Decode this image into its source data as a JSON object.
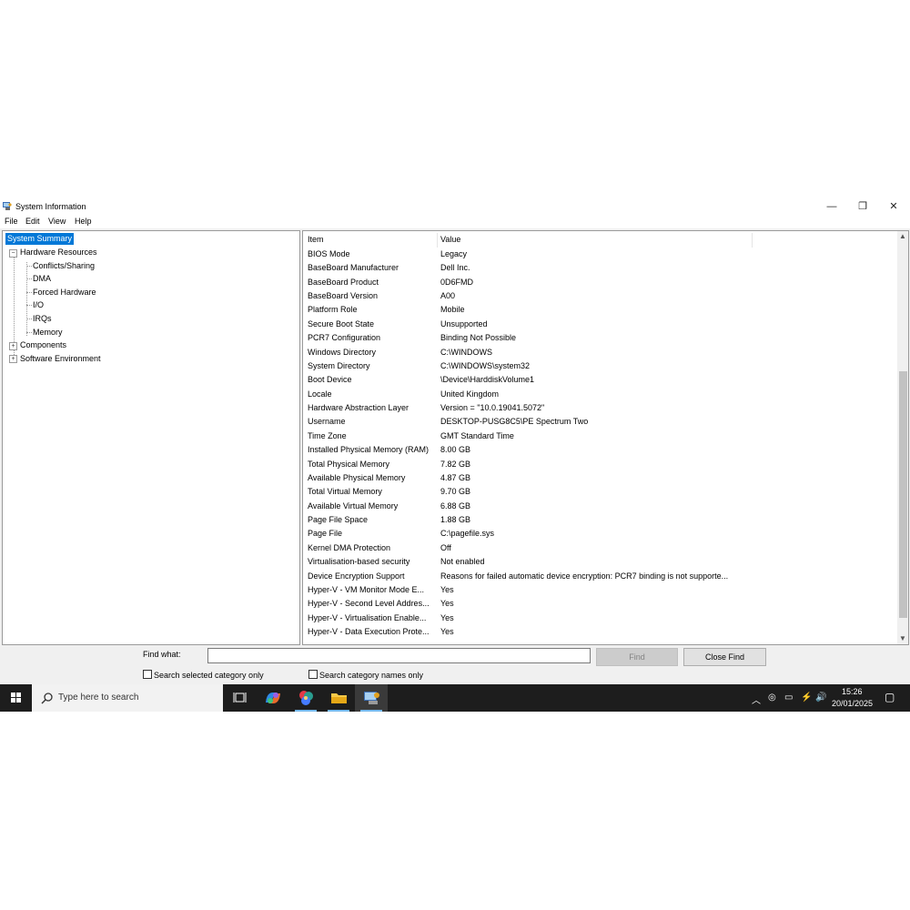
{
  "window": {
    "title": "System Information",
    "controls": {
      "minimize": "—",
      "restore": "❐",
      "close": "✕"
    }
  },
  "menu": [
    "File",
    "Edit",
    "View",
    "Help"
  ],
  "tree": {
    "items": [
      "System Summary",
      "Hardware Resources",
      "Conflicts/Sharing",
      "DMA",
      "Forced Hardware",
      "I/O",
      "IRQs",
      "Memory",
      "Components",
      "Software Environment"
    ]
  },
  "list": {
    "headers": {
      "item": "Item",
      "value": "Value"
    },
    "rows": [
      {
        "item": "BIOS Mode",
        "value": "Legacy"
      },
      {
        "item": "BaseBoard Manufacturer",
        "value": "Dell Inc."
      },
      {
        "item": "BaseBoard Product",
        "value": "0D6FMD"
      },
      {
        "item": "BaseBoard Version",
        "value": "A00"
      },
      {
        "item": "Platform Role",
        "value": "Mobile"
      },
      {
        "item": "Secure Boot State",
        "value": "Unsupported"
      },
      {
        "item": "PCR7 Configuration",
        "value": "Binding Not Possible"
      },
      {
        "item": "Windows Directory",
        "value": "C:\\WINDOWS"
      },
      {
        "item": "System Directory",
        "value": "C:\\WINDOWS\\system32"
      },
      {
        "item": "Boot Device",
        "value": "\\Device\\HarddiskVolume1"
      },
      {
        "item": "Locale",
        "value": "United Kingdom"
      },
      {
        "item": "Hardware Abstraction Layer",
        "value": "Version = \"10.0.19041.5072\""
      },
      {
        "item": "Username",
        "value": "DESKTOP-PUSG8C5\\PE Spectrum Two"
      },
      {
        "item": "Time Zone",
        "value": "GMT Standard Time"
      },
      {
        "item": "Installed Physical Memory (RAM)",
        "value": "8.00 GB"
      },
      {
        "item": "Total Physical Memory",
        "value": "7.82 GB"
      },
      {
        "item": "Available Physical Memory",
        "value": "4.87 GB"
      },
      {
        "item": "Total Virtual Memory",
        "value": "9.70 GB"
      },
      {
        "item": "Available Virtual Memory",
        "value": "6.88 GB"
      },
      {
        "item": "Page File Space",
        "value": "1.88 GB"
      },
      {
        "item": "Page File",
        "value": "C:\\pagefile.sys"
      },
      {
        "item": "Kernel DMA Protection",
        "value": "Off"
      },
      {
        "item": "Virtualisation-based security",
        "value": "Not enabled"
      },
      {
        "item": "Device Encryption Support",
        "value": "Reasons for failed automatic device encryption: PCR7 binding is not supporte..."
      },
      {
        "item": "Hyper-V - VM Monitor Mode E...",
        "value": "Yes"
      },
      {
        "item": "Hyper-V - Second Level Addres...",
        "value": "Yes"
      },
      {
        "item": "Hyper-V - Virtualisation Enable...",
        "value": "Yes"
      },
      {
        "item": "Hyper-V - Data Execution Prote...",
        "value": "Yes"
      }
    ],
    "scroll": {
      "thumb_start": 0.33,
      "thumb_end": 0.96
    }
  },
  "find": {
    "label": "Find what:",
    "value": "",
    "find_button": "Find",
    "close_button": "Close Find",
    "check1": "Search selected category only",
    "check2": "Search category names only"
  },
  "taskbar": {
    "search_placeholder": "Type here to search",
    "time": "15:26",
    "date": "20/01/2025"
  },
  "colors": {
    "selection": "#0078d7",
    "taskbar": "#1d1d1d"
  }
}
